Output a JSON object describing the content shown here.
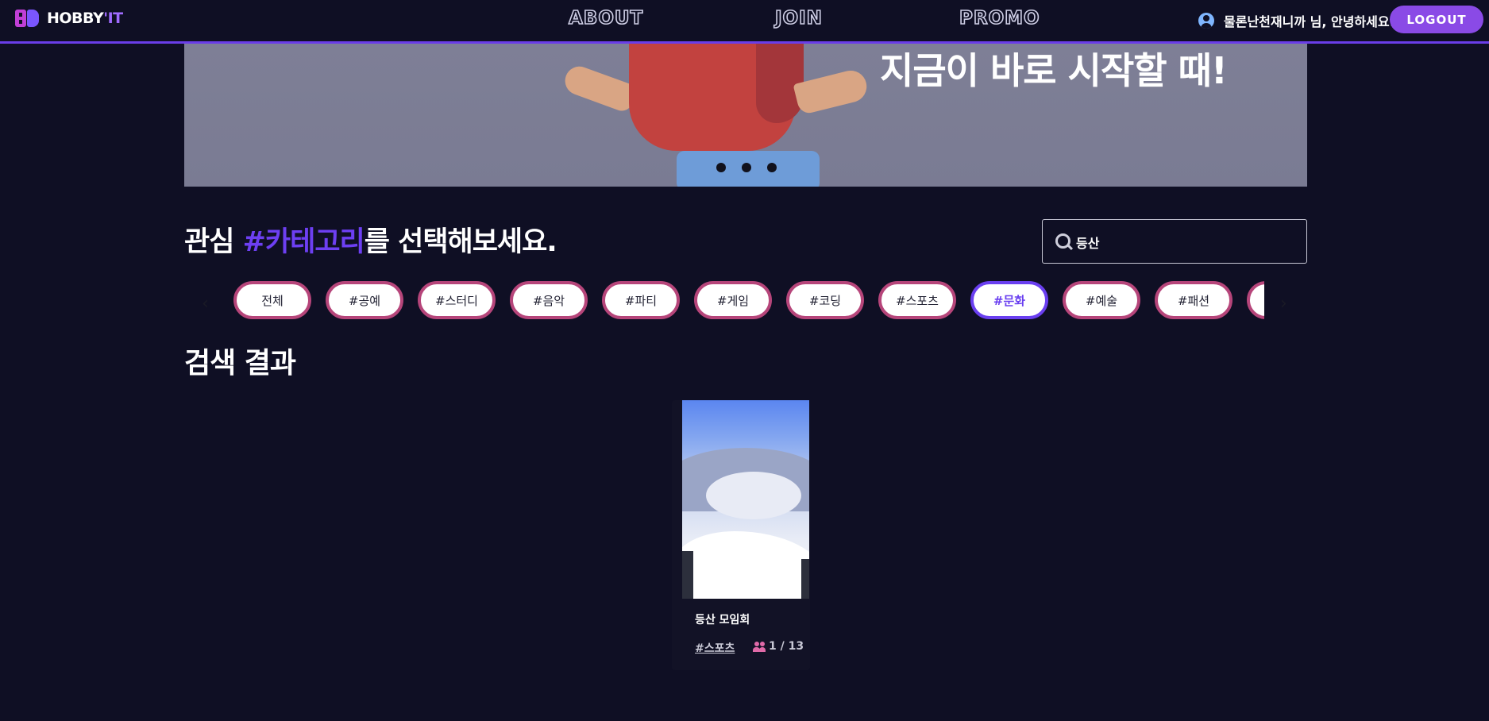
{
  "header": {
    "logo_text_white": "HOBBY",
    "logo_text_accent": "'IT",
    "nav": [
      "ABOUT",
      "JOIN",
      "PROMO"
    ],
    "greeting": "물론난천재니까 님, 안녕하세요!",
    "logout_label": "LOGOUT"
  },
  "banner": {
    "headline": "지금이 바로 시작할 때!",
    "slide_count": 3
  },
  "category": {
    "title_prefix": "관심 ",
    "title_accent": "#카테고리",
    "title_suffix": "를 선택해보세요.",
    "search_value": "등산",
    "chips": [
      "전체",
      "#공예",
      "#스터디",
      "#음악",
      "#파티",
      "#게임",
      "#코딩",
      "#스포츠",
      "#문화",
      "#예술",
      "#패션",
      ""
    ],
    "active_chip": "#문화",
    "prev_arrow": "‹",
    "next_arrow": "›"
  },
  "results": {
    "title": "검색 결과",
    "cards": [
      {
        "title": "등산 모임회",
        "tag": "#스포츠",
        "count": "1 / 13"
      }
    ]
  },
  "colors": {
    "background": "#0f0f24",
    "accent": "#6d3ff2",
    "logout": "#8a4ae6",
    "chip_border": "#b6457a"
  }
}
